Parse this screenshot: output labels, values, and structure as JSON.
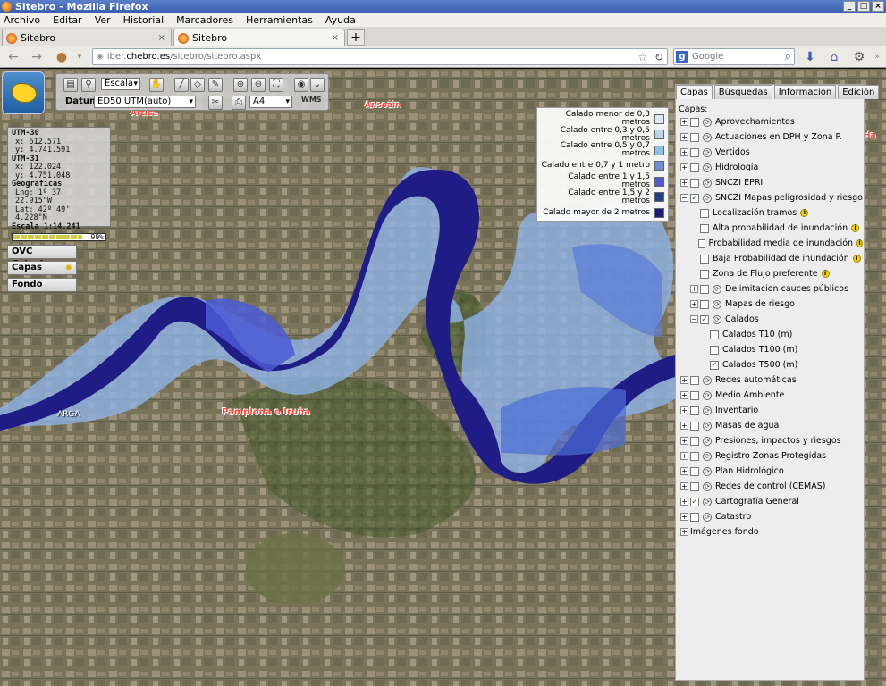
{
  "window": {
    "title": "Sitebro - Mozilla Firefox",
    "min": "_",
    "max": "□",
    "close": "×"
  },
  "menu": [
    "Archivo",
    "Editar",
    "Ver",
    "Historial",
    "Marcadores",
    "Herramientas",
    "Ayuda"
  ],
  "tabs": [
    {
      "label": "Sitebro",
      "close": "×"
    },
    {
      "label": "Sitebro",
      "close": "×"
    }
  ],
  "newtab": "+",
  "nav": {
    "url_prefix": "iber.",
    "url_domain": "chebro.es",
    "url_path": "/sitebro/sitebro.aspx",
    "search_placeholder": "Google",
    "search_engine": "g"
  },
  "toolbar": {
    "escala_label": "Escala",
    "datum_label": "Datum",
    "datum_value": "ED50 UTM(auto)",
    "paper_value": "A4",
    "wms_label": "WMS"
  },
  "coords": {
    "utm30": "UTM-30",
    "utm30_x": "x:   612.571",
    "utm30_y": "y: 4.741.591",
    "utm31": "UTM-31",
    "utm31_x": "x:   122.024",
    "utm31_y": "y: 4.751.048",
    "geo": "Geográficas",
    "lng": "Lng: 1º 37' 22.915\"W",
    "lat": "Lat:  42º 49' 4.228\"N",
    "scale": "Escala 1:14.241",
    "load_pct": "99%",
    "load_fraction": 0.99
  },
  "side_buttons": {
    "catastro": "OVC Catastro",
    "capas": "Capas",
    "fondo": "Fondo"
  },
  "map_labels": {
    "artica": "Artica",
    "ansoain": "Ansoáin",
    "arga": "ARGA",
    "pamplona": "Pamplona o Iruña",
    "label_right": "Ha"
  },
  "legend": [
    {
      "label": "Calado menor de 0,3 metros",
      "color": "#dde9f2"
    },
    {
      "label": "Calado entre 0,3 y 0,5 metros",
      "color": "#b9d6ee"
    },
    {
      "label": "Calado entre 0,5 y 0,7 metros",
      "color": "#8fc0e8"
    },
    {
      "label": "Calado entre 0,7 y 1 metro",
      "color": "#6a8fdc"
    },
    {
      "label": "Calado entre 1 y 1,5 metros",
      "color": "#4f5cd1"
    },
    {
      "label": "Calado entre 1,5 y 2 metros",
      "color": "#243e8c"
    },
    {
      "label": "Calado mayor de 2 metros",
      "color": "#191a7a"
    }
  ],
  "panel": {
    "tabs": [
      "Capas",
      "Búsquedas",
      "Información",
      "Edición"
    ],
    "capas_title": "Capas:",
    "layers": [
      {
        "label": "Aprovechamientos",
        "level": 0,
        "exp": "+",
        "cb": "",
        "icon": true
      },
      {
        "label": "Actuaciones en DPH y Zona P.",
        "level": 0,
        "exp": "+",
        "cb": "",
        "icon": true
      },
      {
        "label": "Vertidos",
        "level": 0,
        "exp": "+",
        "cb": "",
        "icon": true
      },
      {
        "label": "Hidrología",
        "level": 0,
        "exp": "+",
        "cb": "",
        "icon": true
      },
      {
        "label": "SNCZI EPRI",
        "level": 0,
        "exp": "+",
        "cb": "",
        "icon": true
      },
      {
        "label": "SNCZI Mapas peligrosidad y riesgo",
        "level": 0,
        "exp": "−",
        "cb": "✓",
        "icon": true
      },
      {
        "label": "Localización tramos",
        "level": 1,
        "exp": "",
        "cb": "",
        "icon": false,
        "info": "i"
      },
      {
        "label": "Alta probabilidad de inundación",
        "level": 1,
        "exp": "",
        "cb": "",
        "icon": false,
        "info": "i"
      },
      {
        "label": "Probabilidad media de inundación",
        "level": 1,
        "exp": "",
        "cb": "",
        "icon": false,
        "info": "i"
      },
      {
        "label": "Baja Probabilidad de inundación",
        "level": 1,
        "exp": "",
        "cb": "",
        "icon": false,
        "info": "i"
      },
      {
        "label": "Zona de Flujo preferente",
        "level": 1,
        "exp": "",
        "cb": "",
        "icon": false,
        "info": "i"
      },
      {
        "label": "Delimitacion cauces públicos",
        "level": 1,
        "exp": "+",
        "cb": "",
        "icon": true
      },
      {
        "label": "Mapas de riesgo",
        "level": 1,
        "exp": "+",
        "cb": "",
        "icon": true
      },
      {
        "label": "Calados",
        "level": 1,
        "exp": "−",
        "cb": "✓",
        "icon": true
      },
      {
        "label": "Calados T10 (m)",
        "level": 2,
        "exp": "",
        "cb": "",
        "icon": false
      },
      {
        "label": "Calados T100 (m)",
        "level": 2,
        "exp": "",
        "cb": "",
        "icon": false
      },
      {
        "label": "Calados T500 (m)",
        "level": 2,
        "exp": "",
        "cb": "✓",
        "icon": false
      },
      {
        "label": "Redes automáticas",
        "level": 0,
        "exp": "+",
        "cb": "",
        "icon": true
      },
      {
        "label": "Medio Ambiente",
        "level": 0,
        "exp": "+",
        "cb": "",
        "icon": true
      },
      {
        "label": "Inventario",
        "level": 0,
        "exp": "+",
        "cb": "",
        "icon": true
      },
      {
        "label": "Masas de agua",
        "level": 0,
        "exp": "+",
        "cb": "",
        "icon": true
      },
      {
        "label": "Presiones, impactos y riesgos",
        "level": 0,
        "exp": "+",
        "cb": "",
        "icon": true
      },
      {
        "label": "Registro Zonas Protegidas",
        "level": 0,
        "exp": "+",
        "cb": "",
        "icon": true
      },
      {
        "label": "Plan Hidrológico",
        "level": 0,
        "exp": "+",
        "cb": "",
        "icon": true
      },
      {
        "label": "Redes de control (CEMAS)",
        "level": 0,
        "exp": "+",
        "cb": "",
        "icon": true
      },
      {
        "label": "Cartografía General",
        "level": 0,
        "exp": "+",
        "cb": "✓",
        "icon": true
      },
      {
        "label": "Catastro",
        "level": 0,
        "exp": "+",
        "cb": "",
        "icon": true
      },
      {
        "label": "Imágenes fondo",
        "level": 0,
        "exp": "+",
        "cb": null,
        "icon": false
      }
    ]
  }
}
